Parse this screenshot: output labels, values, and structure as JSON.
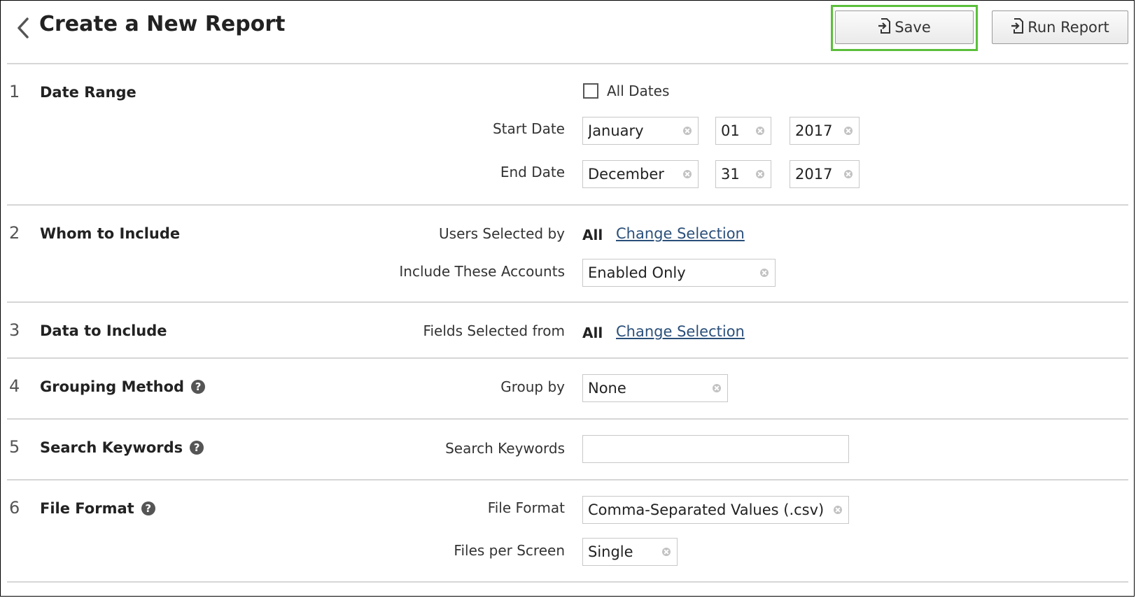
{
  "header": {
    "title": "Create a New Report",
    "save_label": "Save",
    "run_label": "Run Report"
  },
  "sections": [
    {
      "num": "1",
      "title": "Date Range",
      "all_dates_label": "All Dates",
      "start_label": "Start Date",
      "start_month": "January",
      "start_day": "01",
      "start_year": "2017",
      "end_label": "End Date",
      "end_month": "December",
      "end_day": "31",
      "end_year": "2017"
    },
    {
      "num": "2",
      "title": "Whom to Include",
      "users_label": "Users Selected by",
      "users_value": "All",
      "change_label": "Change Selection",
      "accounts_label": "Include These Accounts",
      "accounts_value": "Enabled Only"
    },
    {
      "num": "3",
      "title": "Data to Include",
      "fields_label": "Fields Selected from",
      "fields_value": "All",
      "change_label": "Change Selection"
    },
    {
      "num": "4",
      "title": "Grouping Method",
      "group_label": "Group by",
      "group_value": "None"
    },
    {
      "num": "5",
      "title": "Search Keywords",
      "keywords_label": "Search Keywords",
      "keywords_value": ""
    },
    {
      "num": "6",
      "title": "File Format",
      "format_label": "File Format",
      "format_value": "Comma-Separated Values (.csv)",
      "files_label": "Files per Screen",
      "files_value": "Single"
    }
  ],
  "icons": {
    "back": "chevron-left-icon",
    "save": "file-import-icon",
    "run": "file-import-icon",
    "help": "question-circle-icon",
    "clear": "clear-circle-icon"
  },
  "colors": {
    "highlight": "#5bbf3b",
    "link": "#2a4f7a",
    "divider": "#d6d6d6"
  }
}
